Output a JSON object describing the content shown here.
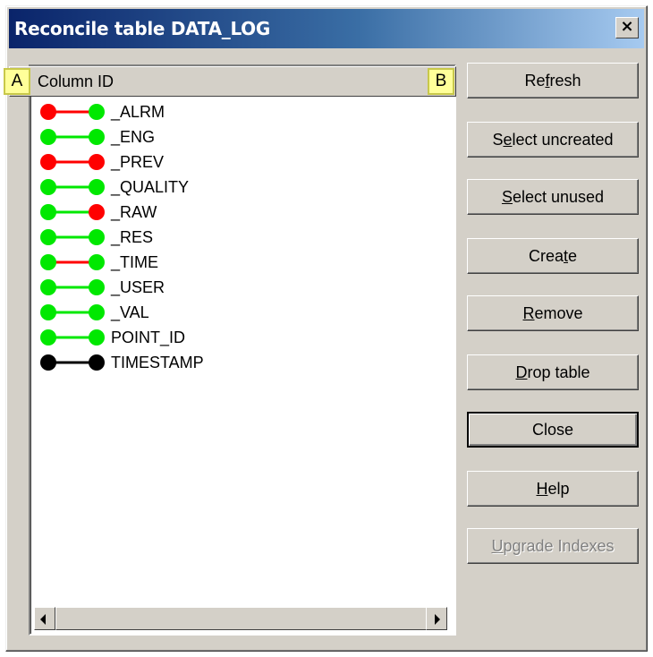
{
  "window": {
    "title": "Reconcile table DATA_LOG",
    "close_glyph": "×"
  },
  "callouts": {
    "a": "A",
    "b": "B"
  },
  "list": {
    "header": "Column ID",
    "colors": {
      "green": "#00e800",
      "red": "#ff0000",
      "black": "#000000"
    },
    "rows": [
      {
        "label": "_ALRM",
        "left": "red",
        "line": "red",
        "right": "green"
      },
      {
        "label": "_ENG",
        "left": "green",
        "line": "green",
        "right": "green"
      },
      {
        "label": "_PREV",
        "left": "red",
        "line": "red",
        "right": "red"
      },
      {
        "label": "_QUALITY",
        "left": "green",
        "line": "green",
        "right": "green"
      },
      {
        "label": "_RAW",
        "left": "green",
        "line": "green",
        "right": "red"
      },
      {
        "label": "_RES",
        "left": "green",
        "line": "green",
        "right": "green"
      },
      {
        "label": "_TIME",
        "left": "green",
        "line": "red",
        "right": "green"
      },
      {
        "label": "_USER",
        "left": "green",
        "line": "green",
        "right": "green"
      },
      {
        "label": "_VAL",
        "left": "green",
        "line": "green",
        "right": "green"
      },
      {
        "label": "POINT_ID",
        "left": "green",
        "line": "green",
        "right": "green"
      },
      {
        "label": "TIMESTAMP",
        "left": "black",
        "line": "black",
        "right": "black"
      }
    ]
  },
  "buttons": [
    {
      "name": "refresh-button",
      "pre": "Re",
      "key": "f",
      "post": "resh",
      "state": "normal"
    },
    {
      "name": "select-uncreated-button",
      "pre": "S",
      "key": "e",
      "post": "lect uncreated",
      "state": "normal"
    },
    {
      "name": "select-unused-button",
      "pre": "",
      "key": "S",
      "post": "elect unused",
      "state": "normal"
    },
    {
      "name": "create-button",
      "pre": "Crea",
      "key": "t",
      "post": "e",
      "state": "normal"
    },
    {
      "name": "remove-button",
      "pre": "",
      "key": "R",
      "post": "emove",
      "state": "normal"
    },
    {
      "name": "drop-table-button",
      "pre": "",
      "key": "D",
      "post": "rop table",
      "state": "normal"
    },
    {
      "name": "close-button",
      "pre": "",
      "key": "",
      "post": "Close",
      "state": "default"
    },
    {
      "name": "help-button",
      "pre": "",
      "key": "H",
      "post": "elp",
      "state": "normal"
    },
    {
      "name": "upgrade-indexes-button",
      "pre": "",
      "key": "U",
      "post": "pgrade Indexes",
      "state": "disabled"
    }
  ]
}
